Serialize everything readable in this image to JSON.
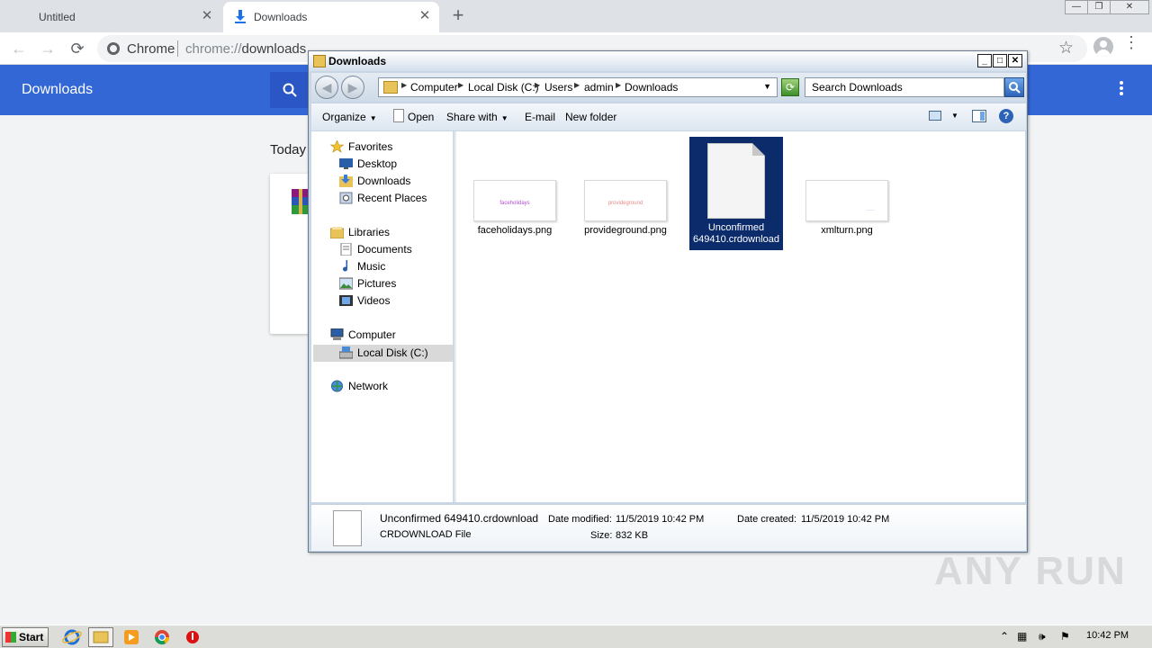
{
  "chrome": {
    "tabs": [
      {
        "label": "Untitled",
        "close": "✕"
      },
      {
        "label": "Downloads",
        "close": "✕"
      }
    ],
    "new_tab": "+",
    "nav": {
      "back": "←",
      "forward": "→",
      "reload": "⟳"
    },
    "omnibox": {
      "scheme_label": "Chrome",
      "url_prefix": "chrome://",
      "url_host": "downloads"
    },
    "star": "☆",
    "window_controls": {
      "minimize": "—",
      "restore": "❐",
      "close": "✕"
    }
  },
  "downloads_page": {
    "title": "Downloads",
    "section_label": "Today"
  },
  "explorer": {
    "title": "Downloads",
    "breadcrumbs": [
      "Computer",
      "Local Disk (C:)",
      "Users",
      "admin",
      "Downloads"
    ],
    "search_placeholder": "Search Downloads",
    "commands": {
      "organize": "Organize",
      "open": "Open",
      "share_with": "Share with",
      "email": "E-mail",
      "new_folder": "New folder",
      "help": "?"
    },
    "nav_pane": {
      "favorites": {
        "label": "Favorites",
        "items": [
          "Desktop",
          "Downloads",
          "Recent Places"
        ]
      },
      "libraries": {
        "label": "Libraries",
        "items": [
          "Documents",
          "Music",
          "Pictures",
          "Videos"
        ]
      },
      "computer": {
        "label": "Computer",
        "items": [
          "Local Disk (C:)"
        ]
      },
      "network": {
        "label": "Network"
      }
    },
    "files": [
      {
        "name": "faceholidays.png",
        "thumb_text": "faceholidays",
        "thumb_color": "#b04fd0"
      },
      {
        "name": "provideground.png",
        "thumb_text": "provideground",
        "thumb_color": "#e88a8a"
      },
      {
        "name_line1": "Unconfirmed",
        "name_line2": "649410.crdownload",
        "selected": true
      },
      {
        "name": "xmlturn.png",
        "thumb_text": "·····",
        "thumb_color": "#8888cc"
      }
    ],
    "details": {
      "name": "Unconfirmed 649410.crdownload",
      "type": "CRDOWNLOAD File",
      "modified_label": "Date modified:",
      "modified_value": "11/5/2019 10:42 PM",
      "created_label": "Date created:",
      "created_value": "11/5/2019 10:42 PM",
      "size_label": "Size:",
      "size_value": "832 KB"
    }
  },
  "watermark": "ANY RUN",
  "taskbar": {
    "start_label": "Start",
    "clock": "10:42 PM"
  },
  "colors": {
    "chrome_blue": "#3367d6",
    "selection": "#0b2b6b"
  }
}
